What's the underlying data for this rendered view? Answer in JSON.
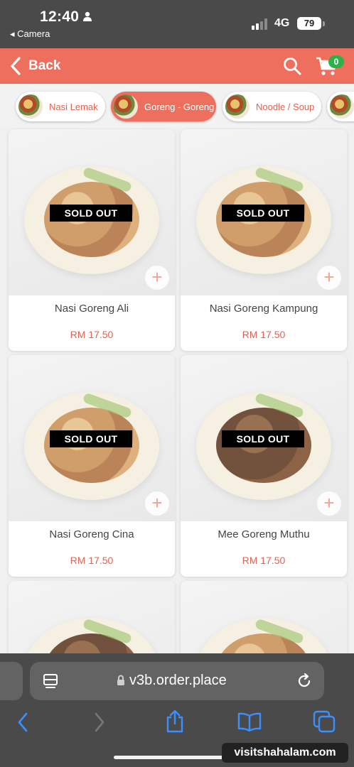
{
  "status_bar": {
    "time": "12:40",
    "back_app": "◂ Camera",
    "network": "4G",
    "battery": "79"
  },
  "header": {
    "back_label": "Back",
    "cart_count": "0",
    "accent_color": "#ef6f5e"
  },
  "categories": [
    {
      "label": "Nasi Lemak",
      "active": false
    },
    {
      "label": "Goreng - Goreng",
      "active": true
    },
    {
      "label": "Noodle / Soup",
      "active": false
    },
    {
      "label": "",
      "active": false
    }
  ],
  "products": [
    {
      "name": "Nasi Goreng Ali",
      "price": "RM 17.50",
      "status": "SOLD OUT"
    },
    {
      "name": "Nasi Goreng Kampung",
      "price": "RM 17.50",
      "status": "SOLD OUT"
    },
    {
      "name": "Nasi Goreng Cina",
      "price": "RM 17.50",
      "status": "SOLD OUT"
    },
    {
      "name": "Mee Goreng Muthu",
      "price": "RM 17.50",
      "status": "SOLD OUT"
    },
    {
      "name": "",
      "price": "",
      "status": ""
    },
    {
      "name": "",
      "price": "",
      "status": ""
    }
  ],
  "browser": {
    "url": "v3b.order.place"
  },
  "watermark": "visitshahalam.com"
}
